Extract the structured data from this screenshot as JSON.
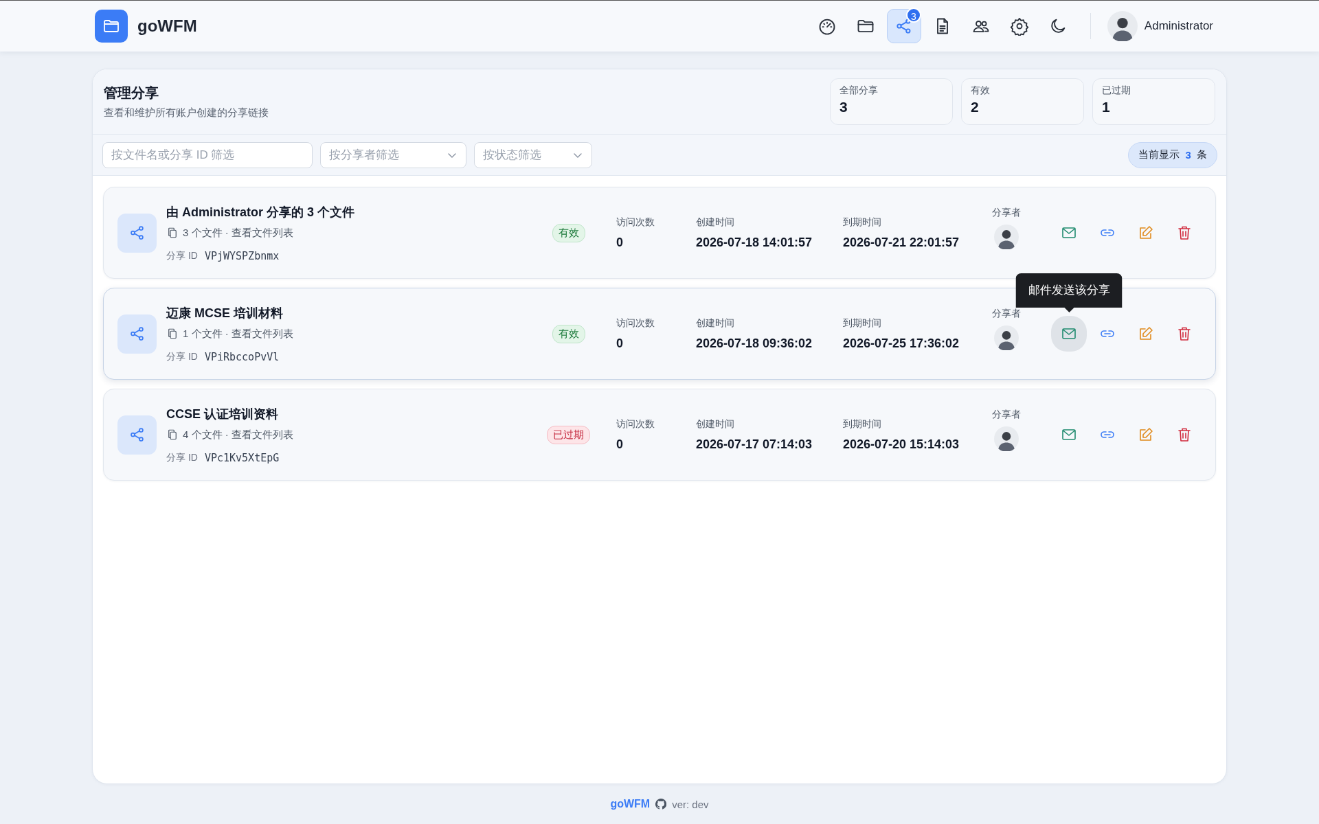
{
  "app": {
    "name": "goWFM"
  },
  "nav": [
    {
      "kind": "dashboard",
      "selected": false
    },
    {
      "kind": "files",
      "selected": false
    },
    {
      "kind": "shares",
      "selected": true,
      "badge": "3"
    },
    {
      "kind": "logs",
      "selected": false
    },
    {
      "kind": "users",
      "selected": false
    },
    {
      "kind": "settings",
      "selected": false
    },
    {
      "kind": "theme",
      "selected": false
    }
  ],
  "user": {
    "name": "Administrator"
  },
  "page": {
    "title": "管理分享",
    "subtitle": "查看和维护所有账户创建的分享链接"
  },
  "stats": [
    {
      "label": "全部分享",
      "value": "3"
    },
    {
      "label": "有效",
      "value": "2"
    },
    {
      "label": "已过期",
      "value": "1"
    }
  ],
  "filters": {
    "search": {
      "placeholder": "按文件名或分享 ID 筛选"
    },
    "selects": [
      {
        "placeholder": "按分享者筛选"
      },
      {
        "placeholder": "按状态筛选"
      }
    ]
  },
  "count": {
    "prefix": "当前显示",
    "value": "3",
    "suffix": "条"
  },
  "shares": [
    {
      "title": "由 Administrator 分享的 3 个文件",
      "files": "3 个文件 · 查看文件列表",
      "id_label": "分享 ID",
      "id": "VPjWYSPZbnmx",
      "status": "有效",
      "kind": "valid",
      "visits_label": "访问次数",
      "visits": "0",
      "created_label": "创建时间",
      "created": "2026-07-18 14:01:57",
      "expires_label": "到期时间",
      "expires": "2026-07-21 22:01:57",
      "sharer_label": "分享者",
      "highlighted": false,
      "actions": [
        {
          "kind": "email",
          "hovered": false
        },
        {
          "kind": "link",
          "hovered": false
        },
        {
          "kind": "edit",
          "hovered": false
        },
        {
          "kind": "delete",
          "hovered": false
        }
      ]
    },
    {
      "title": "迈康 MCSE 培训材料",
      "files": "1 个文件 · 查看文件列表",
      "id_label": "分享 ID",
      "id": "VPiRbccoPvVl",
      "status": "有效",
      "kind": "valid",
      "visits_label": "访问次数",
      "visits": "0",
      "created_label": "创建时间",
      "created": "2026-07-18 09:36:02",
      "expires_label": "到期时间",
      "expires": "2026-07-25 17:36:02",
      "sharer_label": "分享者",
      "highlighted": true,
      "actions": [
        {
          "kind": "email",
          "hovered": true,
          "tooltip": "邮件发送该分享"
        },
        {
          "kind": "link",
          "hovered": false
        },
        {
          "kind": "edit",
          "hovered": false
        },
        {
          "kind": "delete",
          "hovered": false
        }
      ]
    },
    {
      "title": "CCSE 认证培训资料",
      "files": "4 个文件 · 查看文件列表",
      "id_label": "分享 ID",
      "id": "VPc1Kv5XtEpG",
      "status": "已过期",
      "kind": "expired",
      "visits_label": "访问次数",
      "visits": "0",
      "created_label": "创建时间",
      "created": "2026-07-17 07:14:03",
      "expires_label": "到期时间",
      "expires": "2026-07-20 15:14:03",
      "sharer_label": "分享者",
      "highlighted": false,
      "actions": [
        {
          "kind": "email",
          "hovered": false
        },
        {
          "kind": "link",
          "hovered": false
        },
        {
          "kind": "edit",
          "hovered": false
        },
        {
          "kind": "delete",
          "hovered": false
        }
      ]
    }
  ],
  "footer": {
    "link": "goWFM",
    "version": "ver: dev"
  }
}
